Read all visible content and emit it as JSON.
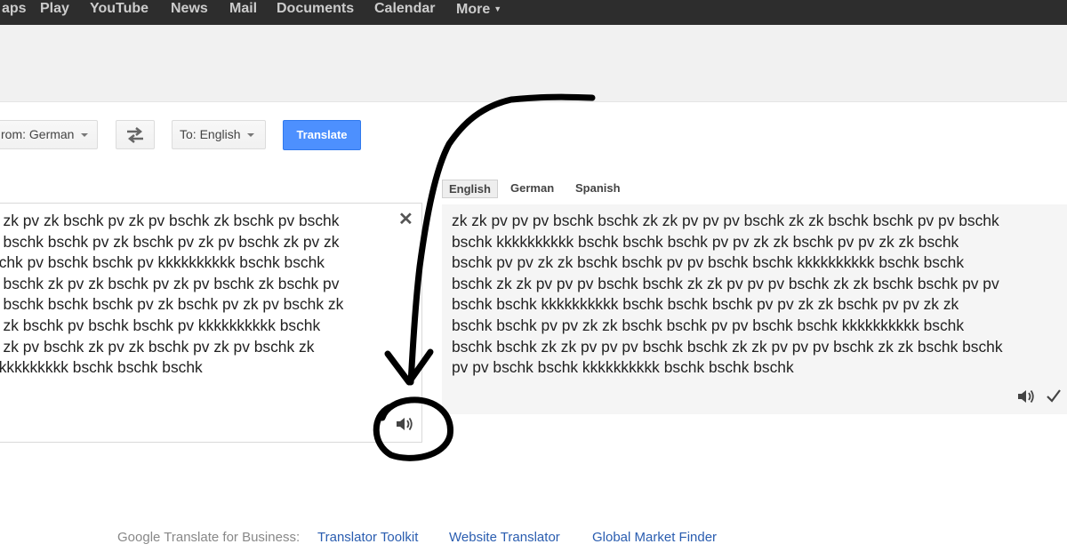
{
  "topnav": {
    "items": [
      "aps",
      "Play",
      "YouTube",
      "News",
      "Mail",
      "Documents",
      "Calendar",
      "More"
    ]
  },
  "toolbar": {
    "from_label": "rom: German",
    "to_label": "To: English",
    "translate_label": "Translate",
    "swap_icon": "swap-arrows-icon"
  },
  "source": {
    "clear_icon": "close-icon",
    "lines": [
      "k zk pv zk bschk pv zk pv bschk zk bschk pv bschk",
      "k bschk bschk pv zk bschk pv zk pv bschk zk pv zk",
      "schk pv bschk bschk pv kkkkkkkkkk bschk bschk",
      "v bschk zk pv zk bschk pv zk pv bschk zk bschk pv",
      "k bschk bschk bschk pv zk bschk pv zk pv bschk zk",
      "k zk bschk pv bschk bschk pv kkkkkkkkkk bschk",
      "v zk pv bschk zk pv zk bschk pv zk pv bschk zk",
      "kkkkkkkkkk bschk bschk bschk"
    ],
    "speaker_icon": "speaker-icon"
  },
  "target": {
    "tabs": [
      "English",
      "German",
      "Spanish"
    ],
    "active_tab": "English",
    "lines": [
      "zk zk pv pv pv bschk bschk zk zk pv pv pv bschk zk zk bschk bschk pv pv bschk",
      "bschk kkkkkkkkkk bschk bschk bschk pv pv zk zk bschk pv pv zk zk bschk",
      "bschk pv pv zk zk bschk bschk pv pv bschk bschk kkkkkkkkkk bschk bschk",
      "bschk zk zk pv pv pv bschk bschk zk zk pv pv pv bschk zk zk bschk bschk pv pv",
      "bschk bschk kkkkkkkkkk bschk bschk bschk pv pv zk zk bschk pv pv zk zk",
      "bschk bschk pv pv zk zk bschk bschk pv pv bschk bschk kkkkkkkkkk bschk",
      "bschk bschk zk zk pv pv pv bschk bschk zk zk pv pv pv bschk zk zk bschk bschk",
      "pv pv bschk bschk kkkkkkkkkk bschk bschk bschk"
    ],
    "speaker_icon": "speaker-icon",
    "check_icon": "check-icon"
  },
  "footer": {
    "label": "Google Translate for Business:",
    "links": [
      "Translator Toolkit",
      "Website Translator",
      "Global Market Finder"
    ]
  },
  "colors": {
    "topbar": "#2d2d2d",
    "accent_button": "#4d90fe",
    "link": "#2a5db0"
  }
}
